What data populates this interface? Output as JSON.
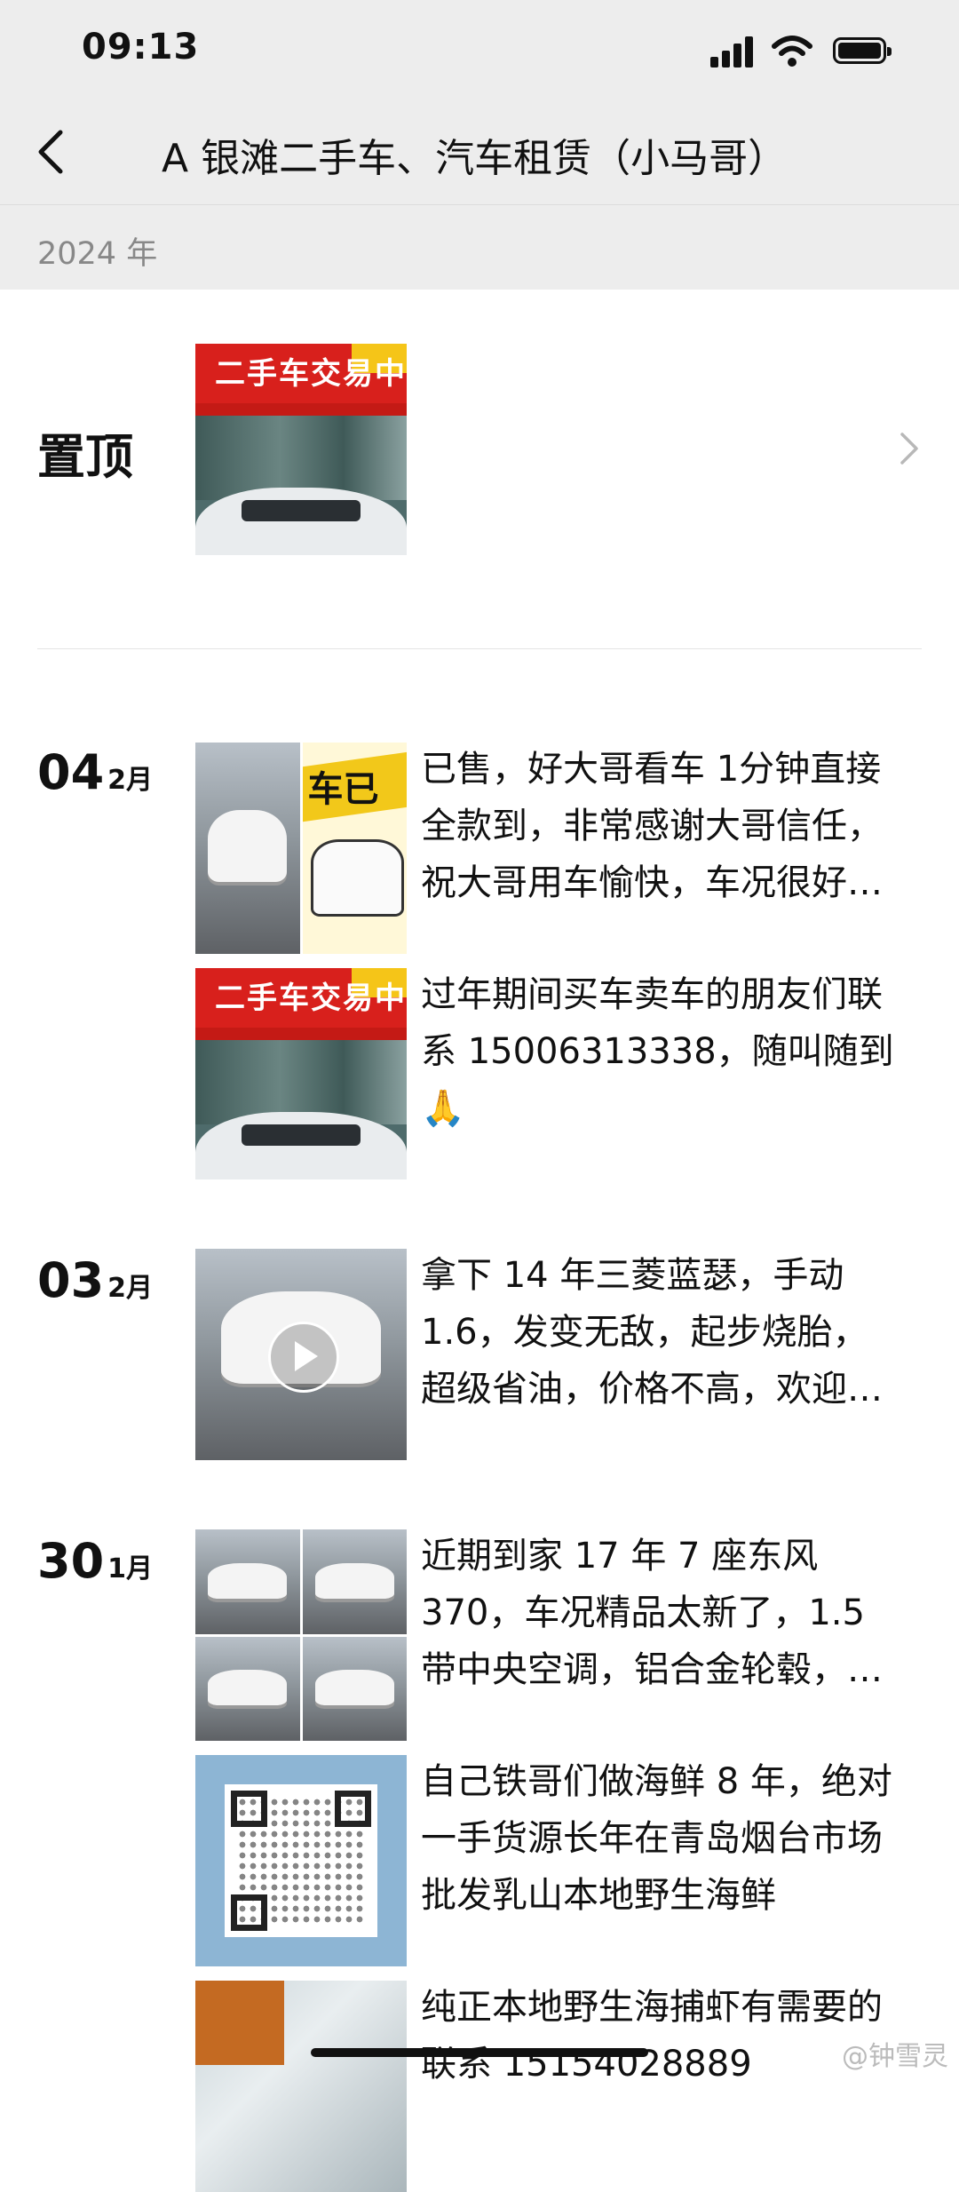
{
  "status_bar": {
    "time": "09:13"
  },
  "nav": {
    "title": "A 银滩二手车、汽车租赁（小马哥）"
  },
  "year_label": "2024 年",
  "pinned": {
    "label": "置顶",
    "sign_text": "二手车交易中"
  },
  "posts": [
    {
      "day": "04",
      "month": "2月",
      "text": "已售，好大哥看车 1分钟直接全款到，非常感谢大哥信任，祝大哥用车愉快，车况很好，诚信交易，欢迎选购"
    },
    {
      "text": "过年期间买车卖车的朋友们联系 15006313338，随叫随到🙏"
    },
    {
      "day": "03",
      "month": "2月",
      "text": "拿下 14 年三菱蓝瑟，手动1.6，发变无敌，起步烧胎，超级省油，价格不高，欢迎选购"
    },
    {
      "day": "30",
      "month": "1月",
      "text": "近期到家 17 年 7 座东风370，车况精品太新了，1.5 带中央空调，铝合金轮毂，欢迎看车"
    },
    {
      "text": "自己铁哥们做海鲜 8 年，绝对一手货源长年在青岛烟台市场批发乳山本地野生海鲜"
    },
    {
      "text": "纯正本地野生海捕虾有需要的联系 15154028889"
    }
  ],
  "promo_text": "车已",
  "watermark": "@钟雪灵"
}
